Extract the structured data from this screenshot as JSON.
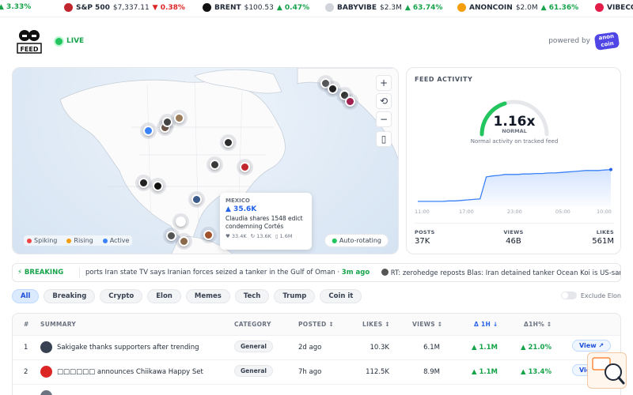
{
  "ticker": [
    {
      "symbol": "",
      "price": "",
      "change": "▲ 3.33%",
      "dir": "up",
      "color": ""
    },
    {
      "symbol": "S&P 500",
      "price": "$7,337.11",
      "change": "▼ 0.38%",
      "dir": "dn",
      "color": "#c0262d"
    },
    {
      "symbol": "BRENT",
      "price": "$100.53",
      "change": "▲ 0.47%",
      "dir": "up",
      "color": "#111111"
    },
    {
      "symbol": "BABYVIBE",
      "price": "$2.3M",
      "change": "▲ 63.74%",
      "dir": "up",
      "color": "#e5e7eb"
    },
    {
      "symbol": "ANONCOIN",
      "price": "$2.0M",
      "change": "▲ 61.36%",
      "dir": "up",
      "color": "#f59e0b"
    },
    {
      "symbol": "VIBECO",
      "price": "",
      "change": "",
      "dir": "up",
      "color": "#e11d48"
    }
  ],
  "header": {
    "live_label": "LIVE",
    "powered_by": "powered by",
    "brand_top": "anon",
    "brand_bottom": "coin"
  },
  "map": {
    "controls": [
      "+",
      "⟲",
      "−",
      "▯"
    ],
    "legend": [
      {
        "label": "Spiking",
        "color": "#ef4444"
      },
      {
        "label": "Rising",
        "color": "#f59e0b"
      },
      {
        "label": "Active",
        "color": "#3b82f6"
      }
    ],
    "auto_rotating": "Auto-rotating",
    "tooltip": {
      "region": "MEXICO",
      "value": "▲ 35.6K",
      "text": "Claudia shares 1548 edict condemning Cortés",
      "likes": "♥ 33.4K",
      "reposts": "↻ 13.6K",
      "views": "▯ 1.6M"
    }
  },
  "feed_activity": {
    "title": "FEED ACTIVITY",
    "multiplier": "1.16x",
    "status": "NORMAL",
    "description": "Normal activity on tracked feed",
    "chart_data": {
      "type": "area",
      "x": [
        "11:00",
        "17:00",
        "23:00",
        "05:00",
        "10:00"
      ],
      "values": [
        0.05,
        0.05,
        0.05,
        0.05,
        0.05,
        0.06,
        0.06,
        0.07,
        0.08,
        0.09,
        0.1,
        0.55,
        0.57,
        0.58,
        0.6,
        0.6,
        0.6,
        0.61,
        0.61,
        0.62,
        0.62,
        0.63,
        0.63,
        0.64,
        0.65,
        0.66,
        0.67,
        0.68,
        0.68,
        0.68,
        0.69,
        0.7
      ]
    },
    "stats": [
      {
        "label": "POSTS",
        "value": "37K"
      },
      {
        "label": "VIEWS",
        "value": "46B"
      },
      {
        "label": "LIKES",
        "value": "561M"
      }
    ]
  },
  "breaking": {
    "label": "⚡ BREAKING",
    "items": [
      {
        "text": "ports Iran state TV says Iranian forces seized a tanker in the Gulf of Oman ·",
        "time": "3m ago"
      },
      {
        "text": "RT: zerohedge reposts Blas: Iran detained tanker Ocean Koi is US-sanct",
        "time": ""
      }
    ]
  },
  "filters": {
    "chips": [
      "All",
      "Breaking",
      "Crypto",
      "Elon",
      "Memes",
      "Tech",
      "Trump",
      "Coin it"
    ],
    "active": "All",
    "exclude_label": "Exclude Elon"
  },
  "table": {
    "headers": {
      "rank": "#",
      "summary": "SUMMARY",
      "category": "CATEGORY",
      "posted": "POSTED ↕",
      "likes": "LIKES ↕",
      "views": "VIEWS ↕",
      "d1h": "Δ 1H ↓",
      "d1hp": "Δ1H% ↕"
    },
    "rows": [
      {
        "rank": "1",
        "summary": "Sakigake thanks supporters after trending",
        "category": "General",
        "posted": "2d ago",
        "likes": "10.3K",
        "views": "6.1M",
        "d1h": "▲ 1.1M",
        "d1hp": "▲ 21.0%",
        "action": "View ↗"
      },
      {
        "rank": "2",
        "summary": "□□□□□□ announces Chiikawa Happy Set",
        "category": "General",
        "posted": "7h ago",
        "likes": "112.5K",
        "views": "8.9M",
        "d1h": "▲ 1.1M",
        "d1hp": "▲ 13.4%",
        "action": "View ↗"
      }
    ]
  }
}
